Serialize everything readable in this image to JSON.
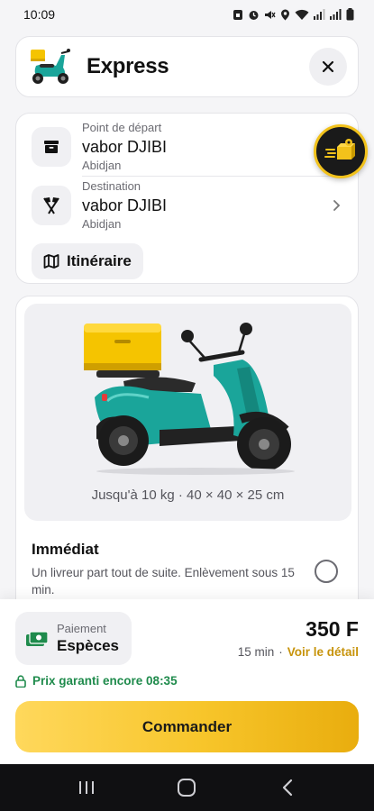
{
  "status_bar": {
    "time": "10:09",
    "icons": [
      "sim-icon",
      "alarm-icon",
      "mute-icon",
      "location-icon",
      "wifi-icon",
      "signal-icon",
      "signal-icon",
      "battery-icon"
    ]
  },
  "header": {
    "title": "Express",
    "close_icon": "close-icon"
  },
  "route": {
    "from": {
      "label": "Point de départ",
      "place": "vabor DJIBI",
      "city": "Abidjan",
      "icon": "box-icon"
    },
    "to": {
      "label": "Destination",
      "place": "vabor DJIBI",
      "city": "Abidjan",
      "icon": "flags-icon"
    },
    "itinerary_label": "Itinéraire"
  },
  "vehicle": {
    "capacity": "Jusqu'à 10 kg · 40 × 40 × 25 cm",
    "option_title": "Immédiat",
    "option_desc": "Un livreur part tout de suite. Enlèvement sous 15 min.",
    "option_selected": false
  },
  "payment": {
    "label": "Paiement",
    "method": "Espèces"
  },
  "summary": {
    "price": "350 F",
    "eta": "15 min",
    "separator": "·",
    "detail_link": "Voir le détail",
    "guarantee": "Prix garanti encore 08:35"
  },
  "order_button": "Commander",
  "colors": {
    "accent": "#f7c52a",
    "link": "#c7930a",
    "guarantee_green": "#1f8b4c",
    "scooter_teal": "#1aa59a",
    "box_yellow": "#f5c400"
  }
}
